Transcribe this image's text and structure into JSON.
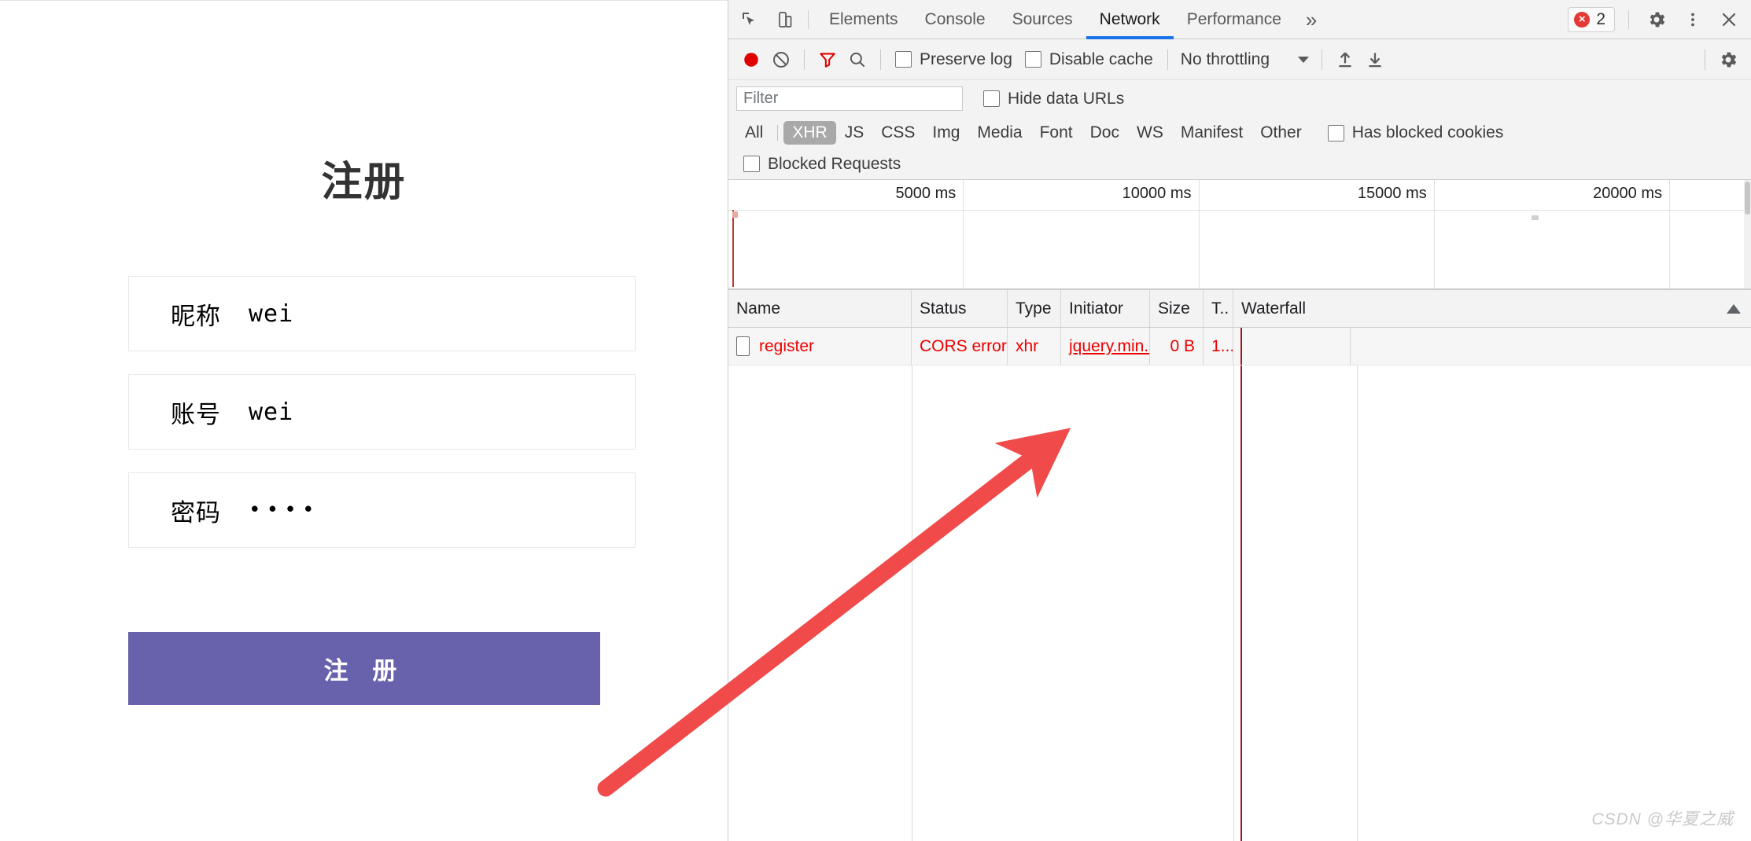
{
  "page": {
    "title": "注册",
    "fields": [
      {
        "name": "nickname",
        "label": "昵称",
        "value": "wei",
        "masked": false
      },
      {
        "name": "account",
        "label": "账号",
        "value": "wei",
        "masked": false
      },
      {
        "name": "password",
        "label": "密码",
        "value": "••••",
        "masked": true
      }
    ],
    "submit_label": "注 册",
    "accent_color": "#6861ab"
  },
  "devtools": {
    "tabs": [
      {
        "label": "Elements",
        "active": false
      },
      {
        "label": "Console",
        "active": false
      },
      {
        "label": "Sources",
        "active": false
      },
      {
        "label": "Network",
        "active": true
      },
      {
        "label": "Performance",
        "active": false
      }
    ],
    "more_tabs_label": "»",
    "error_badge": {
      "count": "2",
      "color": "#e53935",
      "icon": "error-circle-icon"
    },
    "window_icons": {
      "inspect": "inspect-element-icon",
      "device": "device-toolbar-icon",
      "settings": "gear-icon",
      "menu": "three-dots-icon",
      "close": "close-icon"
    },
    "toolbar": {
      "record_tooltip": "record-button",
      "clear_tooltip": "clear-button",
      "filter_tooltip": "filter-button",
      "search_tooltip": "search-button",
      "preserve_log": {
        "label": "Preserve log",
        "checked": false
      },
      "disable_cache": {
        "label": "Disable cache",
        "checked": false
      },
      "throttling": {
        "value": "No throttling"
      },
      "import_tooltip": "import-har-button",
      "export_tooltip": "export-har-button",
      "settings_tooltip": "network-settings-button"
    },
    "filter_bar": {
      "input_value": "",
      "input_placeholder": "Filter",
      "hide_data_urls": {
        "label": "Hide data URLs",
        "checked": false
      }
    },
    "type_filters": [
      {
        "label": "All",
        "selected": false
      },
      {
        "label": "XHR",
        "selected": true
      },
      {
        "label": "JS",
        "selected": false
      },
      {
        "label": "CSS",
        "selected": false
      },
      {
        "label": "Img",
        "selected": false
      },
      {
        "label": "Media",
        "selected": false
      },
      {
        "label": "Font",
        "selected": false
      },
      {
        "label": "Doc",
        "selected": false
      },
      {
        "label": "WS",
        "selected": false
      },
      {
        "label": "Manifest",
        "selected": false
      },
      {
        "label": "Other",
        "selected": false
      }
    ],
    "has_blocked_cookies": {
      "label": "Has blocked cookies",
      "checked": false
    },
    "blocked_requests": {
      "label": "Blocked Requests",
      "checked": false
    },
    "overview": {
      "ticks": [
        "5000 ms",
        "10000 ms",
        "15000 ms",
        "20000 ms",
        ""
      ]
    },
    "table": {
      "columns": [
        {
          "key": "name",
          "label": "Name"
        },
        {
          "key": "status",
          "label": "Status"
        },
        {
          "key": "type",
          "label": "Type"
        },
        {
          "key": "initiator",
          "label": "Initiator"
        },
        {
          "key": "size",
          "label": "Size"
        },
        {
          "key": "time",
          "label": "T.."
        },
        {
          "key": "waterfall",
          "label": "Waterfall"
        }
      ],
      "sort_indicator": "ascending",
      "rows": [
        {
          "name": "register",
          "status": "CORS error",
          "type": "xhr",
          "initiator": "jquery.min....",
          "size": "0 B",
          "time": "1...",
          "is_error": true
        }
      ]
    }
  },
  "annotation": {
    "arrow_color": "#f04a4a",
    "points_at": "CORS error"
  },
  "watermark": "CSDN @华夏之威"
}
